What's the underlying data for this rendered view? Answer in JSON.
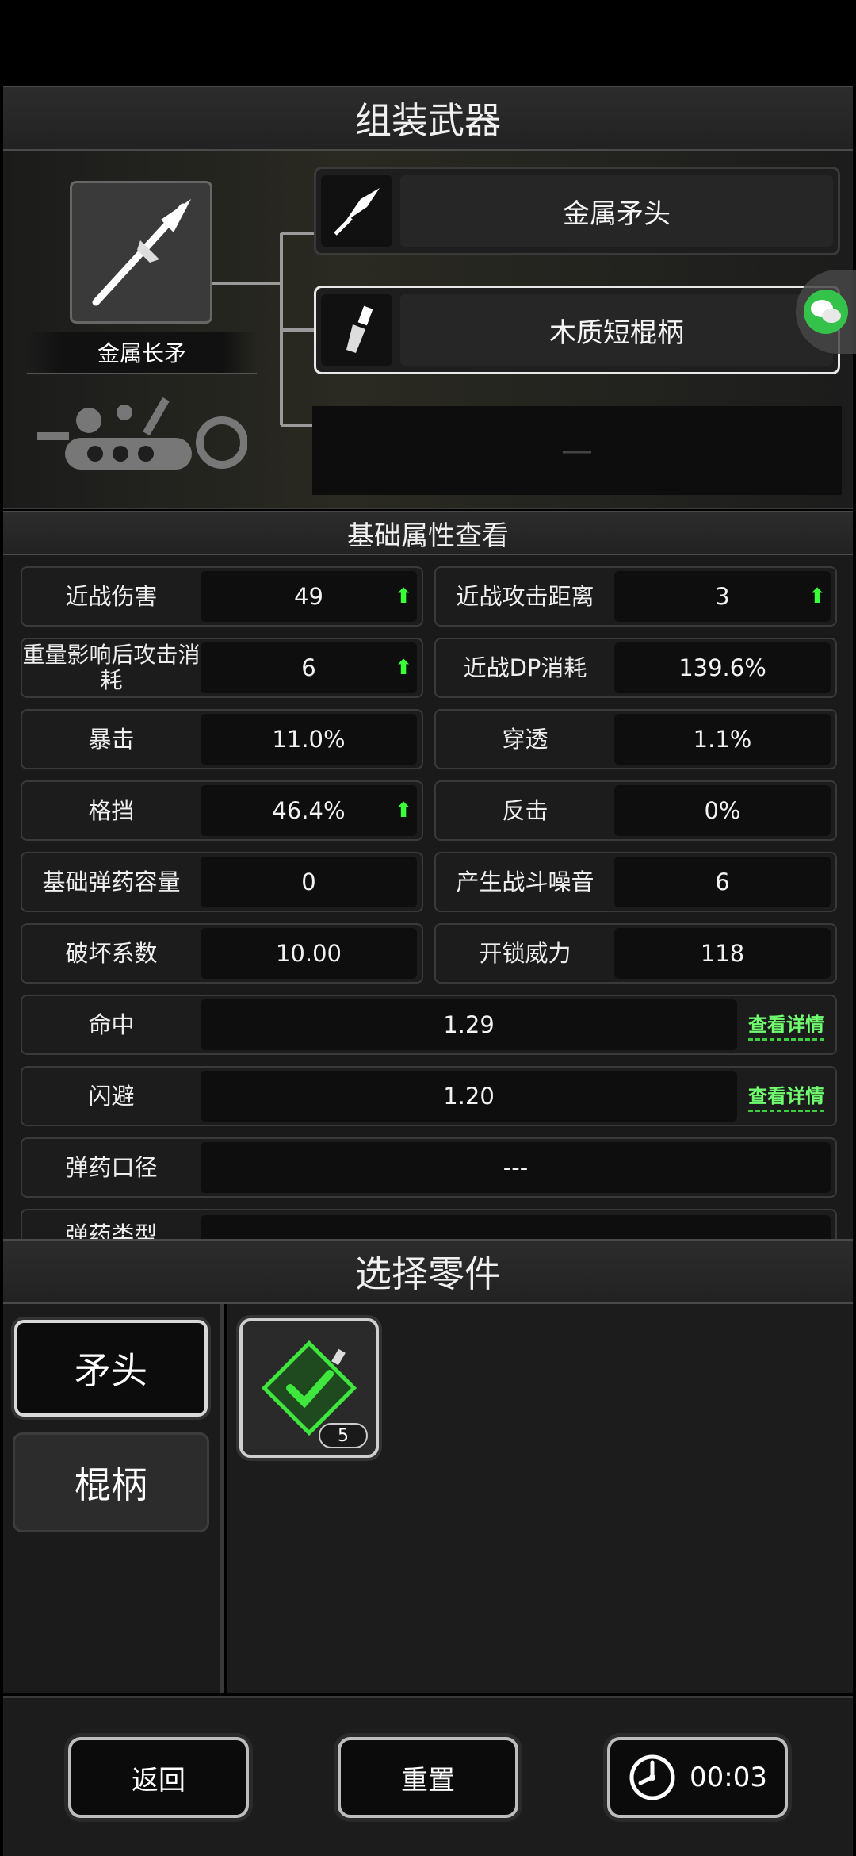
{
  "header": {
    "title": "组装武器"
  },
  "weapon": {
    "name": "金属长矛"
  },
  "slots": [
    {
      "label": "金属矛头",
      "selected": false
    },
    {
      "label": "木质短棍柄",
      "selected": true
    },
    {
      "label": "—",
      "selected": false
    }
  ],
  "stats_header": {
    "title": "基础属性查看"
  },
  "stats": {
    "melee_damage": {
      "label": "近战伤害",
      "value": "49",
      "up": true
    },
    "melee_range": {
      "label": "近战攻击距离",
      "value": "3",
      "up": true
    },
    "weight_cost": {
      "label": "重量影响后攻击消耗",
      "value": "6",
      "up": true
    },
    "melee_dp": {
      "label": "近战DP消耗",
      "value": "139.6%"
    },
    "crit": {
      "label": "暴击",
      "value": "11.0%"
    },
    "pierce": {
      "label": "穿透",
      "value": "1.1%"
    },
    "block": {
      "label": "格挡",
      "value": "46.4%",
      "up": true
    },
    "counter": {
      "label": "反击",
      "value": "0%"
    },
    "ammo_capacity": {
      "label": "基础弹药容量",
      "value": "0"
    },
    "noise": {
      "label": "产生战斗噪音",
      "value": "6"
    },
    "destruction": {
      "label": "破坏系数",
      "value": "10.00"
    },
    "unlock_power": {
      "label": "开锁威力",
      "value": "118"
    },
    "hit": {
      "label": "命中",
      "value": "1.29",
      "link": "查看详情"
    },
    "dodge": {
      "label": "闪避",
      "value": "1.20",
      "link": "查看详情"
    },
    "caliber": {
      "label": "弹药口径",
      "value": "---"
    },
    "ammo_type": {
      "label": "弹药类型"
    }
  },
  "parts_header": {
    "title": "选择零件"
  },
  "categories": [
    {
      "label": "矛头",
      "selected": true
    },
    {
      "label": "棍柄",
      "selected": false
    }
  ],
  "parts": [
    {
      "count": "5"
    }
  ],
  "buttons": {
    "back": "返回",
    "reset": "重置",
    "timer": "00:03"
  },
  "colors": {
    "accent_green": "#3bff3b",
    "background": "#000000"
  }
}
